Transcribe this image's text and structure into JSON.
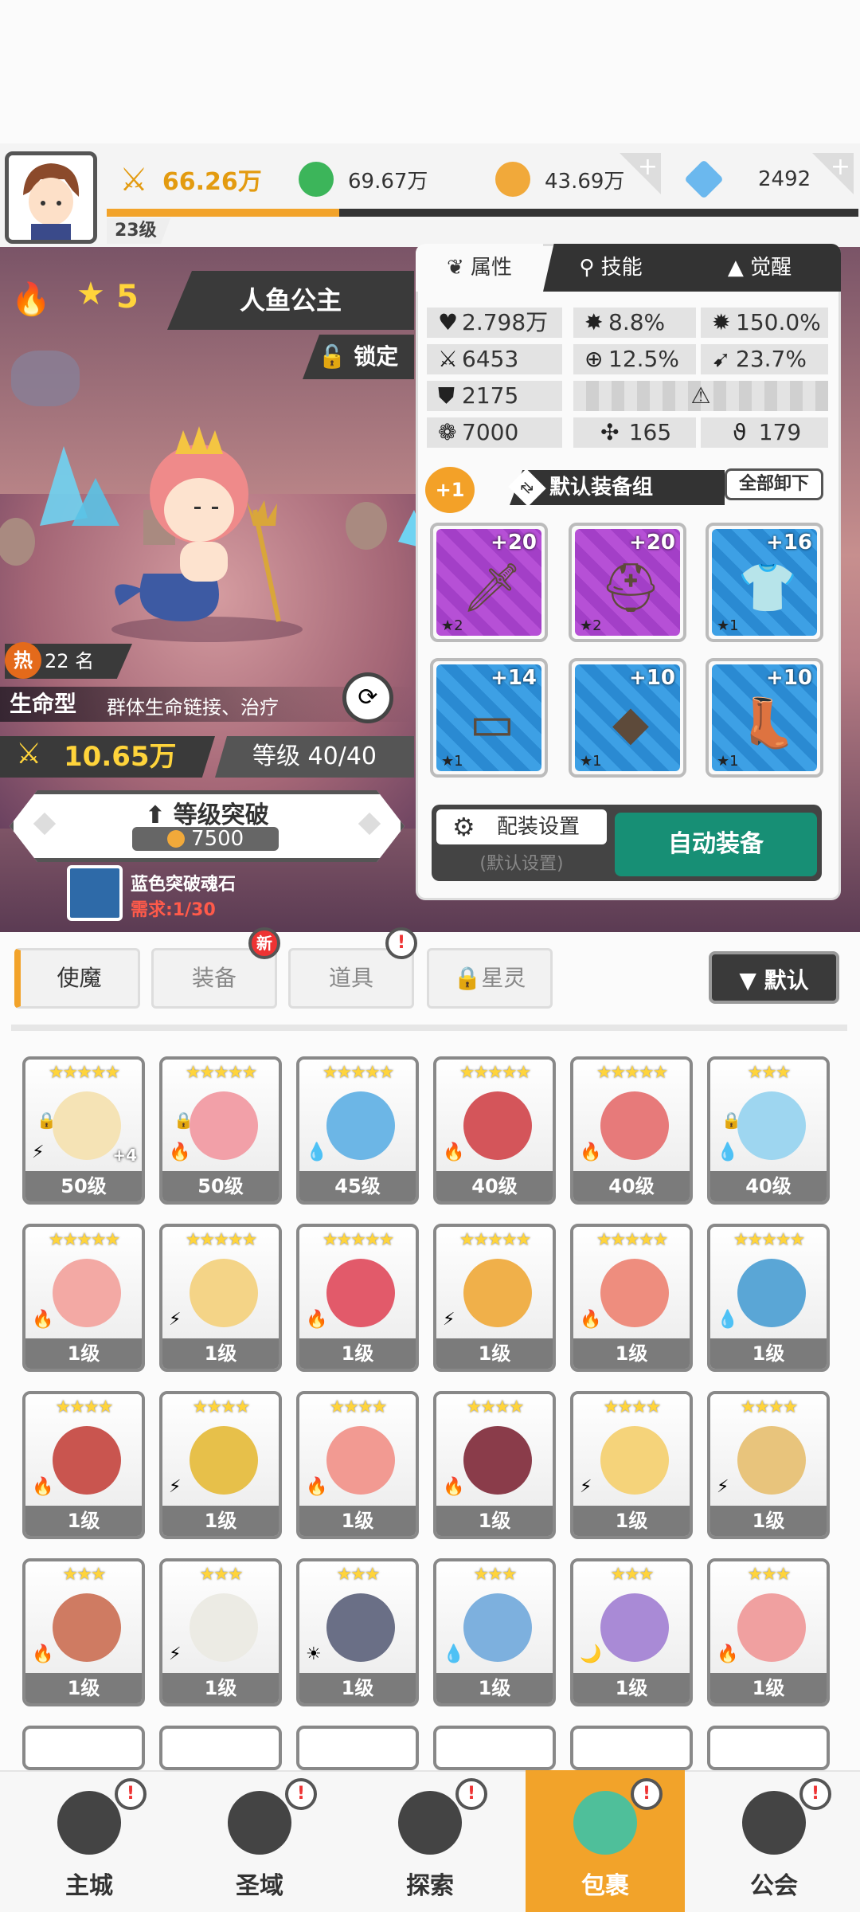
{
  "top": {
    "level": "23级",
    "resources": [
      {
        "name": "power",
        "value": "66.26万",
        "icon": "sword-icon",
        "color": "#e39b10"
      },
      {
        "name": "green-orb",
        "value": "69.67万",
        "icon": "green-orb-icon",
        "color": "#3cb55a"
      },
      {
        "name": "gold",
        "value": "43.69万",
        "icon": "gold-coin-icon",
        "color": "#f1a93a"
      },
      {
        "name": "gem",
        "value": "2492",
        "icon": "crystal-icon",
        "color": "#6bb8ee"
      }
    ]
  },
  "hero": {
    "stars": "5",
    "name": "人鱼公主",
    "lock": "锁定",
    "hot_badge": "热",
    "hot_rank": "22 名",
    "type": "生命型",
    "type_desc": "群体生命链接、治疗",
    "power": "10.65万",
    "level": "等级 40/40",
    "break_title": "等级突破",
    "break_cost": "7500",
    "stone_name": "蓝色突破魂石",
    "stone_req": "需求:1/30"
  },
  "panel": {
    "tabs": [
      "属性",
      "技能",
      "觉醒"
    ],
    "stats": {
      "hp": "2.798万",
      "crit": "8.8%",
      "crit_dmg": "150.0%",
      "atk": "6453",
      "hit": "12.5%",
      "dodge": "23.7%",
      "def": "2175",
      "speed": "7000",
      "s1": "165",
      "s2": "179"
    },
    "plus_one": "+1",
    "group_name": "默认装备组",
    "unequip_all": "全部卸下",
    "equipment": [
      {
        "level": "+20",
        "rank": "★2",
        "rarity": "purple",
        "icon": "sword-icon"
      },
      {
        "level": "+20",
        "rank": "★2",
        "rarity": "purple",
        "icon": "helmet-icon"
      },
      {
        "level": "+16",
        "rank": "★1",
        "rarity": "blue",
        "icon": "armor-icon"
      },
      {
        "level": "+14",
        "rank": "★1",
        "rarity": "blue",
        "icon": "belt-icon"
      },
      {
        "level": "+10",
        "rank": "★1",
        "rarity": "blue",
        "icon": "necklace-icon"
      },
      {
        "level": "+10",
        "rank": "★1",
        "rarity": "blue",
        "icon": "boots-icon"
      }
    ],
    "config_label": "配装设置",
    "config_sub": "(默认设置)",
    "auto_equip": "自动装备"
  },
  "categories": {
    "tabs": [
      "使魔",
      "装备",
      "道具",
      "星灵"
    ],
    "new_badge": "新",
    "alert_badge": "!",
    "sort": "▼ 默认"
  },
  "roster": [
    {
      "stars": "★★★★★",
      "level": "50级",
      "color": "#f5e3b5",
      "elem": "⚡",
      "extra": "+4",
      "locked": true
    },
    {
      "stars": "★★★★★",
      "level": "50级",
      "color": "#f2a0a8",
      "elem": "🔥",
      "locked": true
    },
    {
      "stars": "★★★★★",
      "level": "45级",
      "color": "#6cb6e6",
      "elem": "💧"
    },
    {
      "stars": "★★★★★",
      "level": "40级",
      "color": "#d4555a",
      "elem": "🔥"
    },
    {
      "stars": "★★★★★",
      "level": "40级",
      "color": "#e77a7a",
      "elem": "🔥"
    },
    {
      "stars": "★★★",
      "level": "40级",
      "color": "#9ed6f0",
      "elem": "💧",
      "locked": true
    },
    {
      "stars": "★★★★★",
      "level": "1级",
      "color": "#f3a9a4",
      "elem": "🔥"
    },
    {
      "stars": "★★★★★",
      "level": "1级",
      "color": "#f4d487",
      "elem": "⚡"
    },
    {
      "stars": "★★★★★",
      "level": "1级",
      "color": "#e25a6a",
      "elem": "🔥"
    },
    {
      "stars": "★★★★★",
      "level": "1级",
      "color": "#f0b04a",
      "elem": "⚡"
    },
    {
      "stars": "★★★★★",
      "level": "1级",
      "color": "#ee8d7e",
      "elem": "🔥"
    },
    {
      "stars": "★★★★★",
      "level": "1级",
      "color": "#5aa6d6",
      "elem": "💧"
    },
    {
      "stars": "★★★★",
      "level": "1级",
      "color": "#c9554f",
      "elem": "🔥"
    },
    {
      "stars": "★★★★",
      "level": "1级",
      "color": "#e7c04a",
      "elem": "⚡"
    },
    {
      "stars": "★★★★",
      "level": "1级",
      "color": "#f29a92",
      "elem": "🔥"
    },
    {
      "stars": "★★★★",
      "level": "1级",
      "color": "#8a3c4a",
      "elem": "🔥"
    },
    {
      "stars": "★★★★",
      "level": "1级",
      "color": "#f5d37a",
      "elem": "⚡"
    },
    {
      "stars": "★★★★",
      "level": "1级",
      "color": "#e8c47c",
      "elem": "⚡"
    },
    {
      "stars": "★★★",
      "level": "1级",
      "color": "#cf7b62",
      "elem": "🔥"
    },
    {
      "stars": "★★★",
      "level": "1级",
      "color": "#ecebe4",
      "elem": "⚡"
    },
    {
      "stars": "★★★",
      "level": "1级",
      "color": "#6a6f86",
      "elem": "☀"
    },
    {
      "stars": "★★★",
      "level": "1级",
      "color": "#7db0de",
      "elem": "💧"
    },
    {
      "stars": "★★★",
      "level": "1级",
      "color": "#a98ad6",
      "elem": "🌙"
    },
    {
      "stars": "★★★",
      "level": "1级",
      "color": "#f0a0a0",
      "elem": "🔥"
    }
  ],
  "nav": [
    {
      "label": "主城",
      "icon": "castle-icon"
    },
    {
      "label": "圣域",
      "icon": "vortex-icon"
    },
    {
      "label": "探索",
      "icon": "sword-stone-icon"
    },
    {
      "label": "包裹",
      "icon": "bag-icon",
      "active": true
    },
    {
      "label": "公会",
      "icon": "guild-helmet-icon"
    }
  ]
}
